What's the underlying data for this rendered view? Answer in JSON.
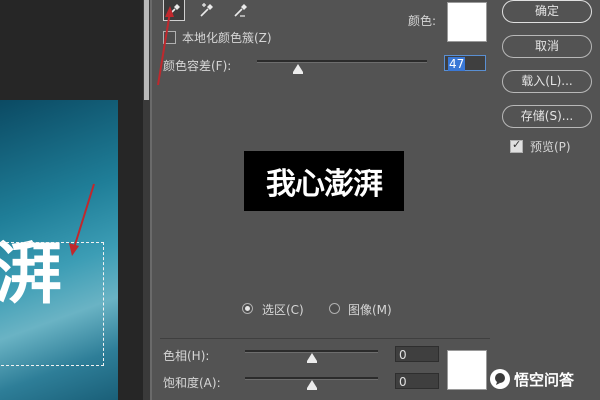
{
  "canvas": {
    "text": "湃"
  },
  "tools": {
    "eyedropper": "eyedropper-icon",
    "eyedropper_add": "eyedropper-plus-icon",
    "eyedropper_sub": "eyedropper-minus-icon"
  },
  "localized_clusters": {
    "label": "本地化颜色簇(Z)",
    "checked": false
  },
  "color_label": "颜色:",
  "fuzziness": {
    "label": "颜色容差(F):",
    "value": "47",
    "level": 0.24
  },
  "preview_image_text": "我心澎湃",
  "radios": {
    "selection": "选区(C)",
    "image": "图像(M)",
    "selected": "selection"
  },
  "buttons": {
    "ok": "确定",
    "cancel": "取消",
    "load": "载入(L)...",
    "save": "存储(S)..."
  },
  "preview_toggle": {
    "label": "预览(P)",
    "checked": true
  },
  "hue": {
    "label": "色相(H):",
    "value": "0",
    "level": 0.5
  },
  "saturation": {
    "label": "饱和度(A):",
    "value": "0",
    "level": 0.5
  },
  "colors": {
    "background": "#535353",
    "swatch": "#ffffff",
    "accent": "#3a78d6",
    "arrow": "#c0282d"
  },
  "watermark": {
    "text": "悟空问答"
  }
}
